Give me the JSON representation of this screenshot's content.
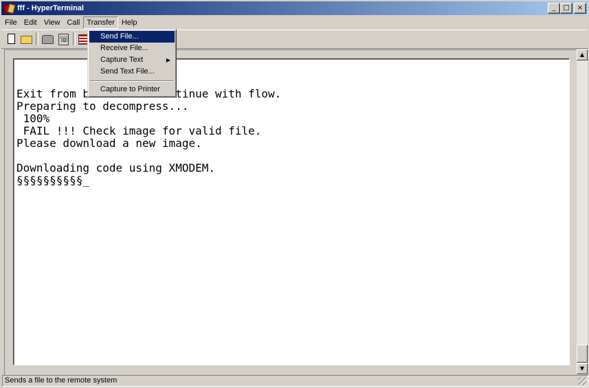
{
  "window": {
    "title": "fff - HyperTerminal",
    "minimize_glyph": "_",
    "maximize_glyph": "□",
    "close_glyph": "×"
  },
  "menubar": {
    "items": [
      "File",
      "Edit",
      "View",
      "Call",
      "Transfer",
      "Help"
    ],
    "open_item": "Transfer"
  },
  "transfer_menu": {
    "items": [
      {
        "label": "Send File...",
        "selected": true
      },
      {
        "label": "Receive File..."
      },
      {
        "label": "Capture Text",
        "has_submenu": true
      },
      {
        "label": "Send Text File..."
      },
      {
        "label": "Capture to Printer"
      }
    ]
  },
  "toolbar": {
    "icons": [
      "new-connection-icon",
      "open-icon",
      "connect-phone-icon",
      "disconnect-icon",
      "send-icon"
    ]
  },
  "terminal": {
    "text": "Exit from boot menu. Continue with flow.\nPreparing to decompress...\n 100%\n FAIL !!! Check image for valid file.\nPlease download a new image.\n\nDownloading code using XMODEM.\n§§§§§§§§§§_"
  },
  "statusbar": {
    "text": "Sends a file to the remote system"
  },
  "colors": {
    "face": "#d4d0c8",
    "titlebar_start": "#0a246a",
    "titlebar_end": "#a6caf0",
    "highlight": "#0a246a"
  }
}
